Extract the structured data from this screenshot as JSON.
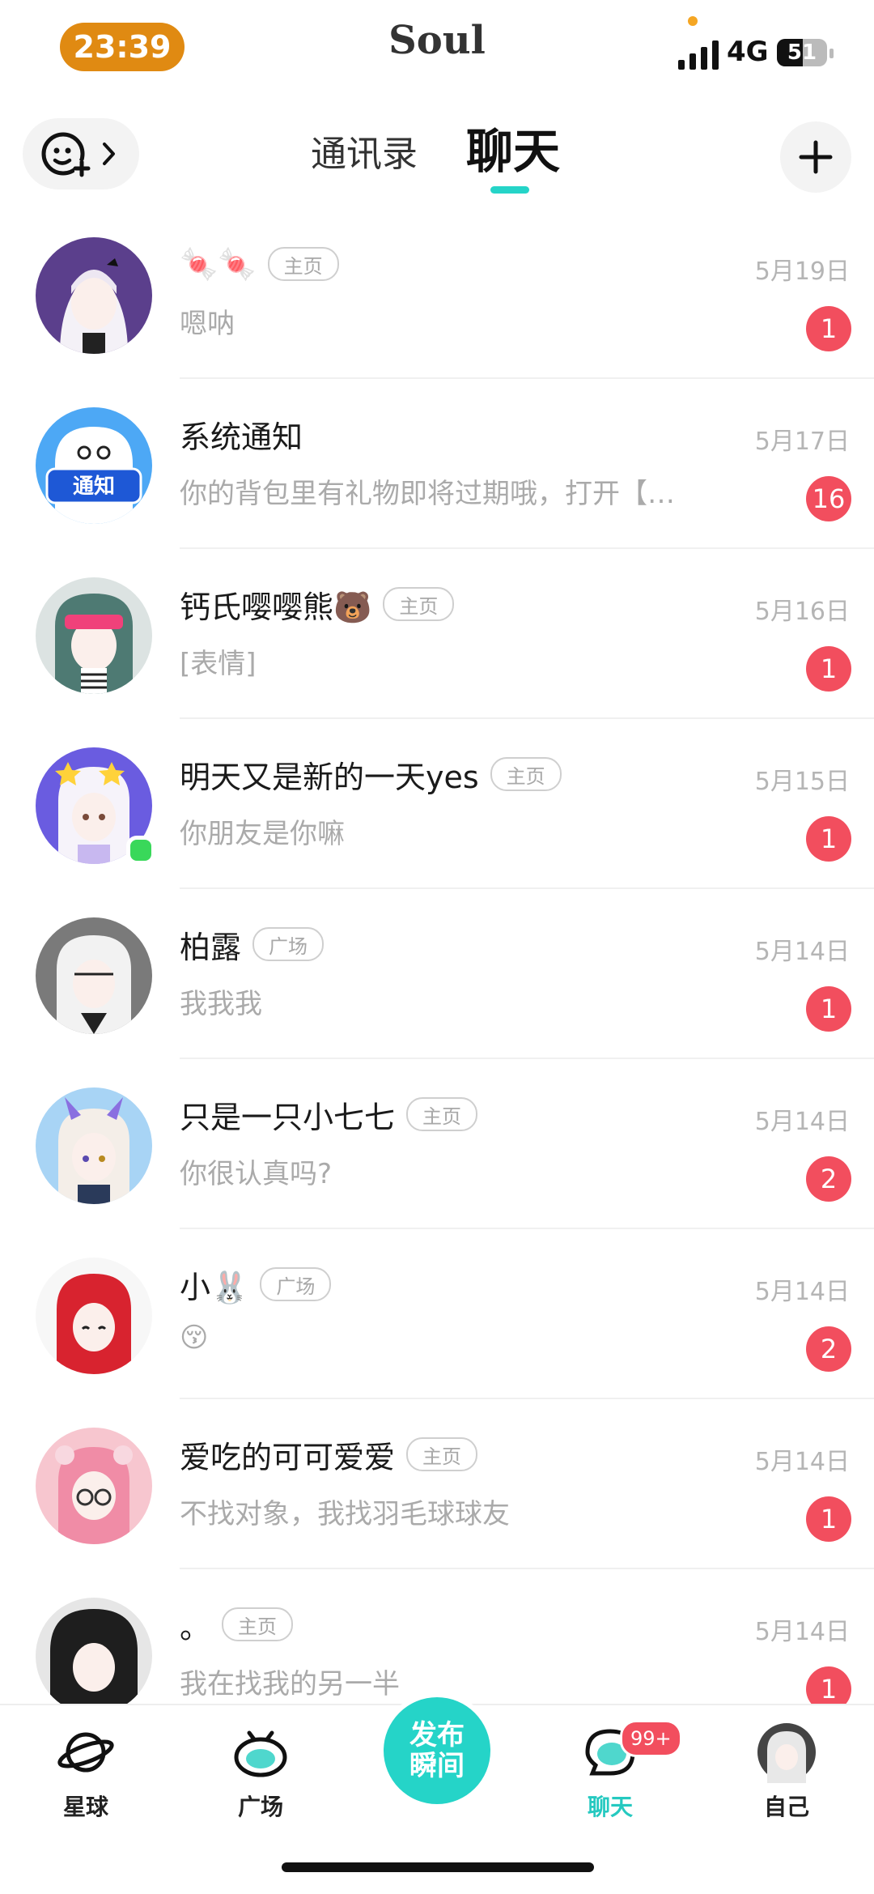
{
  "status": {
    "time": "23:39",
    "app_name": "Soul",
    "network": "4G",
    "battery_level": "51",
    "battery_fraction": 0.51
  },
  "header": {
    "tab_contacts": "通讯录",
    "tab_chat": "聊天"
  },
  "conversations": [
    {
      "name": "🍬🍬",
      "tag": "主页",
      "date": "5月19日",
      "preview": "嗯呐",
      "unread": "1"
    },
    {
      "name": "系统通知",
      "tag": "",
      "date": "5月17日",
      "preview": "你的背包里有礼物即将过期哦，打开【…",
      "unread": "16",
      "avatar_text": "通知"
    },
    {
      "name": "钙氏嘤嘤熊🐻",
      "tag": "主页",
      "date": "5月16日",
      "preview": "[表情]",
      "unread": "1"
    },
    {
      "name": "明天又是新的一天yes",
      "tag": "主页",
      "date": "5月15日",
      "preview": "你朋友是你嘛",
      "unread": "1"
    },
    {
      "name": "柏露",
      "tag": "广场",
      "date": "5月14日",
      "preview": "我我我",
      "unread": "1"
    },
    {
      "name": "只是一只小七七",
      "tag": "主页",
      "date": "5月14日",
      "preview": "你很认真吗?",
      "unread": "2"
    },
    {
      "name": "小🐰",
      "tag": "广场",
      "date": "5月14日",
      "preview": "😚",
      "unread": "2"
    },
    {
      "name": "爱吃的可可爱爱",
      "tag": "主页",
      "date": "5月14日",
      "preview": "不找对象，我找羽毛球球友",
      "unread": "1"
    },
    {
      "name": "。",
      "tag": "主页",
      "date": "5月14日",
      "preview": "我在找我的另一半",
      "unread": "1"
    }
  ],
  "nav": {
    "planet": "星球",
    "square": "广场",
    "publish_line1": "发布",
    "publish_line2": "瞬间",
    "chat": "聊天",
    "chat_badge": "99+",
    "me": "自己"
  },
  "colors": {
    "accent": "#25D4C8",
    "badge": "#F24E5E",
    "time_pill": "#E08A12"
  }
}
